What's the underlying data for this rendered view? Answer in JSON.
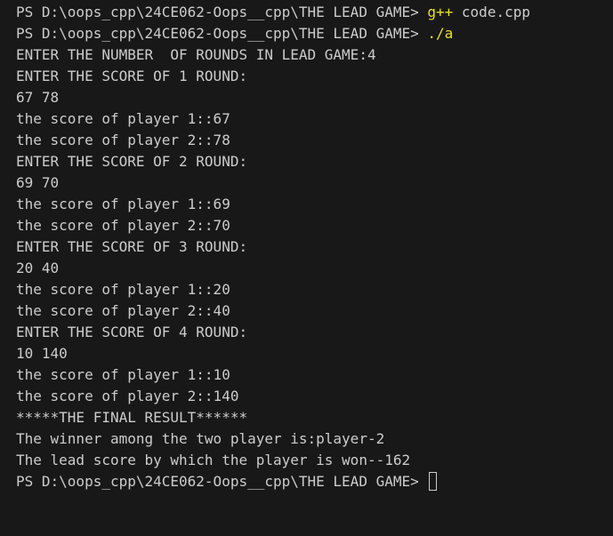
{
  "terminal": {
    "prompt": "PS D:\\oops_cpp\\24CE062-Oops__cpp\\THE LEAD GAME> ",
    "commands": [
      {
        "exec": "g++",
        "args": " code.cpp"
      },
      {
        "exec": "./a",
        "args": ""
      }
    ],
    "output": [
      "ENTER THE NUMBER  OF ROUNDS IN LEAD GAME:4",
      "ENTER THE SCORE OF 1 ROUND:",
      "67 78",
      "the score of player 1::67",
      "the score of player 2::78",
      "ENTER THE SCORE OF 2 ROUND:",
      "69 70",
      "the score of player 1::69",
      "the score of player 2::70",
      "ENTER THE SCORE OF 3 ROUND:",
      "20 40",
      "the score of player 1::20",
      "the score of player 2::40",
      "ENTER THE SCORE OF 4 ROUND:",
      "10 140",
      "the score of player 1::10",
      "the score of player 2::140",
      "*****THE FINAL RESULT******",
      "The winner among the two player is:player-2",
      "The lead score by which the player is won--162"
    ],
    "colors": {
      "background": "#181818",
      "text": "#cccccc",
      "command": "#e5e510"
    }
  }
}
